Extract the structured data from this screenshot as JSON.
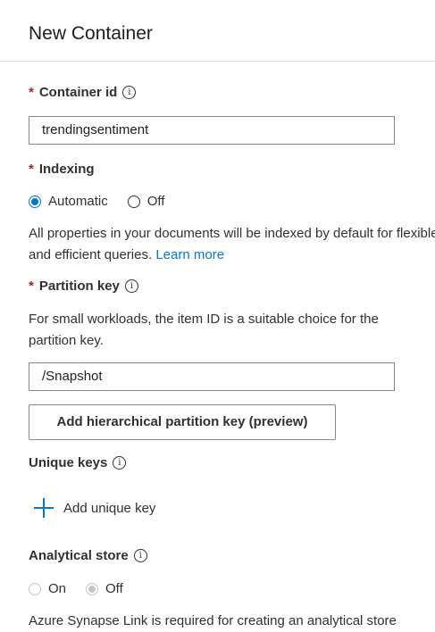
{
  "panel": {
    "title": "New Container"
  },
  "container_id": {
    "label": "Container id",
    "required_mark": "*",
    "value": "trendingsentiment"
  },
  "indexing": {
    "label": "Indexing",
    "required_mark": "*",
    "options": [
      {
        "label": "Automatic",
        "selected": true
      },
      {
        "label": "Off",
        "selected": false
      }
    ],
    "description": "All properties in your documents will be indexed by default for flexible and efficient queries.",
    "learn_more": "Learn more"
  },
  "partition_key": {
    "label": "Partition key",
    "required_mark": "*",
    "description": "For small workloads, the item ID is a suitable choice for the partition key.",
    "value": "/Snapshot",
    "add_hierarchical_button": "Add hierarchical partition key (preview)"
  },
  "unique_keys": {
    "label": "Unique keys",
    "add_label": "Add unique key"
  },
  "analytical_store": {
    "label": "Analytical store",
    "options": [
      {
        "label": "On",
        "selected": false
      },
      {
        "label": "Off",
        "selected": true
      }
    ],
    "description": "Azure Synapse Link is required for creating an analytical store"
  },
  "icons": {
    "info": "info-icon",
    "plus": "plus-icon"
  },
  "colors": {
    "accent": "#0078d4",
    "required": "#a4262c"
  }
}
